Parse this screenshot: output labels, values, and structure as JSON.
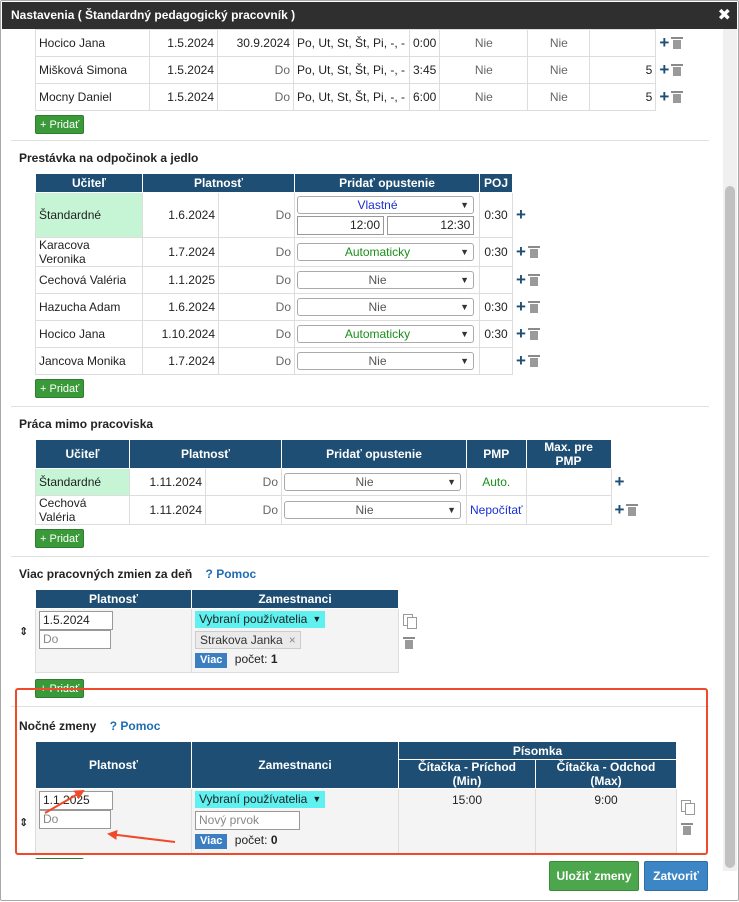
{
  "window": {
    "title": "Nastavenia ( Štandardný pedagogický pracovník )",
    "close_glyph": "✖"
  },
  "top_rows": [
    {
      "name": "Hocico Jana",
      "from": "1.5.2024",
      "to": "30.9.2024",
      "days": "Po, Ut, St, Št, Pi, -, -",
      "time": "0:00",
      "col1": "Nie",
      "col2": "Nie",
      "count": ""
    },
    {
      "name": "Mišková Simona",
      "from": "1.5.2024",
      "to": "Do",
      "days": "Po, Ut, St, Št, Pi, -, -",
      "time": "3:45",
      "col1": "Nie",
      "col2": "Nie",
      "count": "5"
    },
    {
      "name": "Mocny Daniel",
      "from": "1.5.2024",
      "to": "Do",
      "days": "Po, Ut, St, Št, Pi, -, -",
      "time": "6:00",
      "col1": "Nie",
      "col2": "Nie",
      "count": "5"
    }
  ],
  "add_label": "+ Pridať",
  "break_section": {
    "title": "Prestávka na odpočinok a jedlo",
    "headers": [
      "Učiteľ",
      "Platnosť",
      "Pridať opustenie",
      "POJ"
    ],
    "standard": {
      "name": "Štandardné",
      "from": "1.6.2024",
      "to": "Do",
      "select": "Vlastné",
      "time_from": "12:00",
      "time_to": "12:30",
      "poj": "0:30"
    },
    "rows": [
      {
        "name": "Karacova Veronika",
        "from": "1.7.2024",
        "to": "Do",
        "select": "Automaticky",
        "poj": "0:30"
      },
      {
        "name": "Cechová Valéria",
        "from": "1.1.2025",
        "to": "Do",
        "select": "Nie",
        "poj": ""
      },
      {
        "name": "Hazucha Adam",
        "from": "1.6.2024",
        "to": "Do",
        "select": "Nie",
        "poj": "0:30"
      },
      {
        "name": "Hocico Jana",
        "from": "1.10.2024",
        "to": "Do",
        "select": "Automaticky",
        "poj": "0:30"
      },
      {
        "name": "Jancova Monika",
        "from": "1.7.2024",
        "to": "Do",
        "select": "Nie",
        "poj": ""
      }
    ]
  },
  "remote_section": {
    "title": "Práca mimo pracoviska",
    "headers": [
      "Učiteľ",
      "Platnosť",
      "Pridať opustenie",
      "PMP",
      "Max. pre PMP"
    ],
    "rows": [
      {
        "name": "Štandardné",
        "from": "1.11.2024",
        "to": "Do",
        "select": "Nie",
        "pmp": "Auto.",
        "max": ""
      },
      {
        "name": "Cechová Valéria",
        "from": "1.11.2024",
        "to": "Do",
        "select": "Nie",
        "pmp": "Nepočítať",
        "max": ""
      }
    ]
  },
  "multi_section": {
    "title": "Viac pracovných zmien za deň",
    "help": "Pomoc",
    "help_q": "?",
    "headers": [
      "Platnosť",
      "Zamestnanci"
    ],
    "from": "1.5.2024",
    "to_placeholder": "Do",
    "select": "Vybraní používatelia",
    "tag": "Strakova Janka",
    "tag_x": "×",
    "viac": "Viac",
    "count_label": "počet:",
    "count": "1"
  },
  "night_section": {
    "title": "Nočné zmeny",
    "help": "Pomoc",
    "help_q": "?",
    "headers": [
      "Platnosť",
      "Zamestnanci",
      "Písomka",
      "Čítačka - Príchod (Min)",
      "Čítačka - Odchod (Max)"
    ],
    "from": "1.1.2025",
    "to_placeholder": "Do",
    "select": "Vybraní používatelia",
    "new_item_placeholder": "Nový prvok",
    "viac": "Viac",
    "count_label": "počet:",
    "count": "0",
    "arrival": "15:00",
    "departure": "9:00"
  },
  "footer": {
    "save": "Uložiť zmeny",
    "close": "Zatvoriť"
  },
  "icons": [
    "close-icon",
    "plus-icon",
    "trash-icon",
    "copy-icon",
    "chevron-down-icon",
    "sort-icon"
  ],
  "colors": {
    "header": "#1e4e73",
    "add_button": "#3a9a3a",
    "highlight": "#f04a2a",
    "standard_cell": "#c6f5d6"
  }
}
